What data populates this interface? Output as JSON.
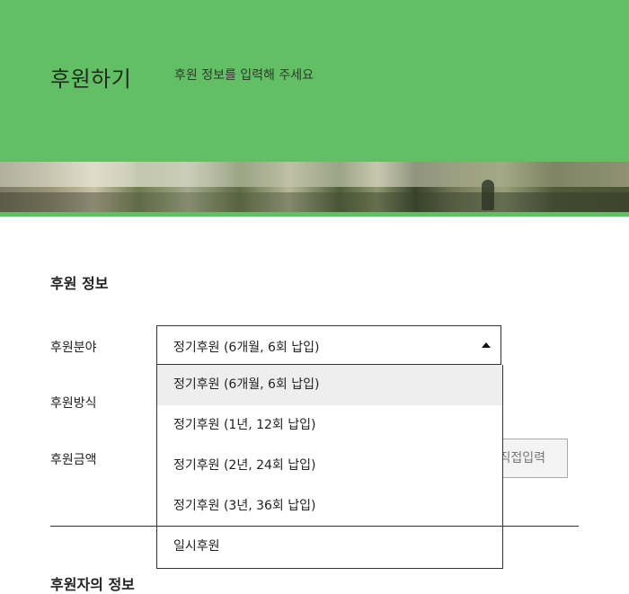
{
  "header": {
    "title": "후원하기",
    "subtitle": "후원 정보를 입력해 주세요"
  },
  "sponsor_info": {
    "section_title": "후원 정보",
    "field_label": "후원분야",
    "method_label": "후원방식",
    "amount_label": "후원금액",
    "selected_value": "정기후원 (6개월, 6회 납입)",
    "options": [
      "정기후원 (6개월, 6회 납입)",
      "정기후원 (1년, 12회 납입)",
      "정기후원 (2년, 24회 납입)",
      "정기후원 (3년, 36회 납입)",
      "일시후원"
    ],
    "direct_input_label": "직접입력"
  },
  "next_section": {
    "title": "후원자의 정보"
  }
}
